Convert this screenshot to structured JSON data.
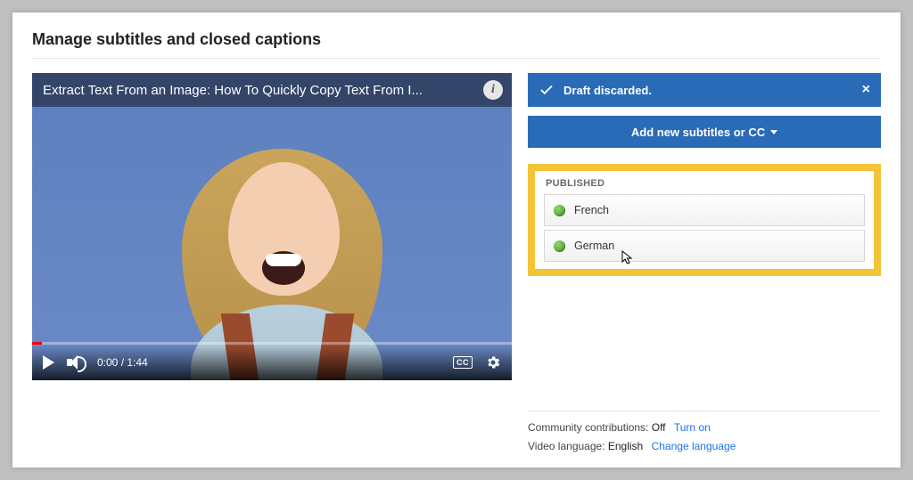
{
  "heading": "Manage subtitles and closed captions",
  "video": {
    "title": "Extract Text From an Image: How To Quickly Copy Text From I...",
    "current_time": "0:00",
    "duration": "1:44",
    "cc_label": "CC"
  },
  "banner": {
    "message": "Draft discarded.",
    "close": "×"
  },
  "add_button": "Add new subtitles or CC",
  "published": {
    "label": "PUBLISHED",
    "items": [
      {
        "name": "French"
      },
      {
        "name": "German"
      }
    ]
  },
  "footer": {
    "contrib_label": "Community contributions:",
    "contrib_value": "Off",
    "contrib_link": "Turn on",
    "lang_label": "Video language:",
    "lang_value": "English",
    "lang_link": "Change language"
  }
}
